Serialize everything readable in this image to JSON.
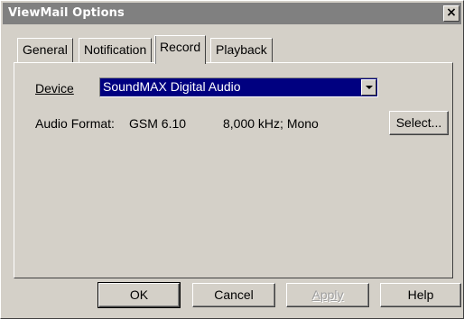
{
  "window": {
    "title": "ViewMail Options",
    "close_label": "×"
  },
  "tabs": [
    {
      "label": "General"
    },
    {
      "label": "Notification"
    },
    {
      "label": "Record"
    },
    {
      "label": "Playback"
    }
  ],
  "active_tab": "Record",
  "record": {
    "device_label": "Device",
    "device_value": "SoundMAX Digital Audio",
    "audio_format_label": "Audio Format:",
    "audio_format_codec": "GSM 6.10",
    "audio_format_detail": "8,000 kHz; Mono",
    "select_button": "Select..."
  },
  "footer": {
    "ok": "OK",
    "cancel": "Cancel",
    "apply": "Apply",
    "help": "Help"
  }
}
